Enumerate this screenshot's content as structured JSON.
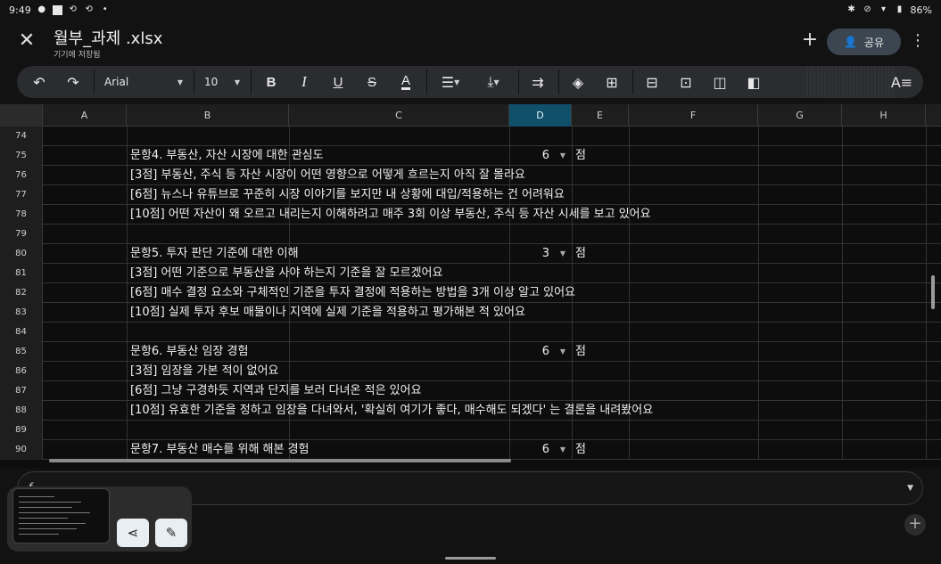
{
  "status": {
    "time": "9:49",
    "battery": "86%"
  },
  "header": {
    "title": "월부_과제 .xlsx",
    "subtitle": "기기에 저장됨",
    "share_label": "공유"
  },
  "toolbar": {
    "font": "Arial",
    "font_size": "10"
  },
  "columns": [
    "A",
    "B",
    "C",
    "D",
    "E",
    "F",
    "G",
    "H"
  ],
  "active_column": "D",
  "rows": [
    {
      "num": "74",
      "b": "",
      "d": "",
      "e": ""
    },
    {
      "num": "75",
      "b": "문항4. 부동산, 자산 시장에 대한 관심도",
      "d": "6",
      "e": "점"
    },
    {
      "num": "76",
      "b": "[3점] 부동산, 주식 등 자산 시장이 어떤 영향으로 어떻게 흐르는지 아직 잘 몰라요",
      "d": "",
      "e": ""
    },
    {
      "num": "77",
      "b": "[6점] 뉴스나 유튜브로 꾸준히 시장 이야기를 보지만 내 상황에 대입/적용하는 건 어려워요",
      "d": "",
      "e": ""
    },
    {
      "num": "78",
      "b": "[10점] 어떤 자산이 왜 오르고 내리는지 이해하려고 매주 3회 이상 부동산, 주식 등 자산 시세를 보고 있어요",
      "d": "",
      "e": ""
    },
    {
      "num": "79",
      "b": "",
      "d": "",
      "e": ""
    },
    {
      "num": "80",
      "b": "문항5. 투자 판단 기준에 대한 이해",
      "d": "3",
      "e": "점"
    },
    {
      "num": "81",
      "b": "[3점] 어떤 기준으로 부동산을 사야 하는지 기준을 잘 모르겠어요",
      "d": "",
      "e": ""
    },
    {
      "num": "82",
      "b": "[6점] 매수 결정 요소와 구체적인 기준을 투자 결정에 적용하는 방법을 3개 이상 알고 있어요",
      "d": "",
      "e": ""
    },
    {
      "num": "83",
      "b": "[10점] 실제 투자 후보 매물이나 지역에 실제 기준을 적용하고 평가해본 적 있어요",
      "d": "",
      "e": ""
    },
    {
      "num": "84",
      "b": "",
      "d": "",
      "e": ""
    },
    {
      "num": "85",
      "b": "문항6. 부동산 임장 경험",
      "d": "6",
      "e": "점"
    },
    {
      "num": "86",
      "b": "[3점] 임장을 가본 적이 없어요",
      "d": "",
      "e": ""
    },
    {
      "num": "87",
      "b": "[6점] 그냥 구경하듯 지역과 단지를 보러 다녀온 적은 있어요",
      "d": "",
      "e": ""
    },
    {
      "num": "88",
      "b": "[10점] 유효한 기준을 정하고 임장을 다녀와서, '확실히 여기가 좋다, 매수해도 되겠다' 는 결론을 내려봤어요",
      "d": "",
      "e": ""
    },
    {
      "num": "89",
      "b": "",
      "d": "",
      "e": ""
    },
    {
      "num": "90",
      "b": "문항7. 부동산 매수를 위해 해본 경험",
      "d": "6",
      "e": "점"
    }
  ]
}
